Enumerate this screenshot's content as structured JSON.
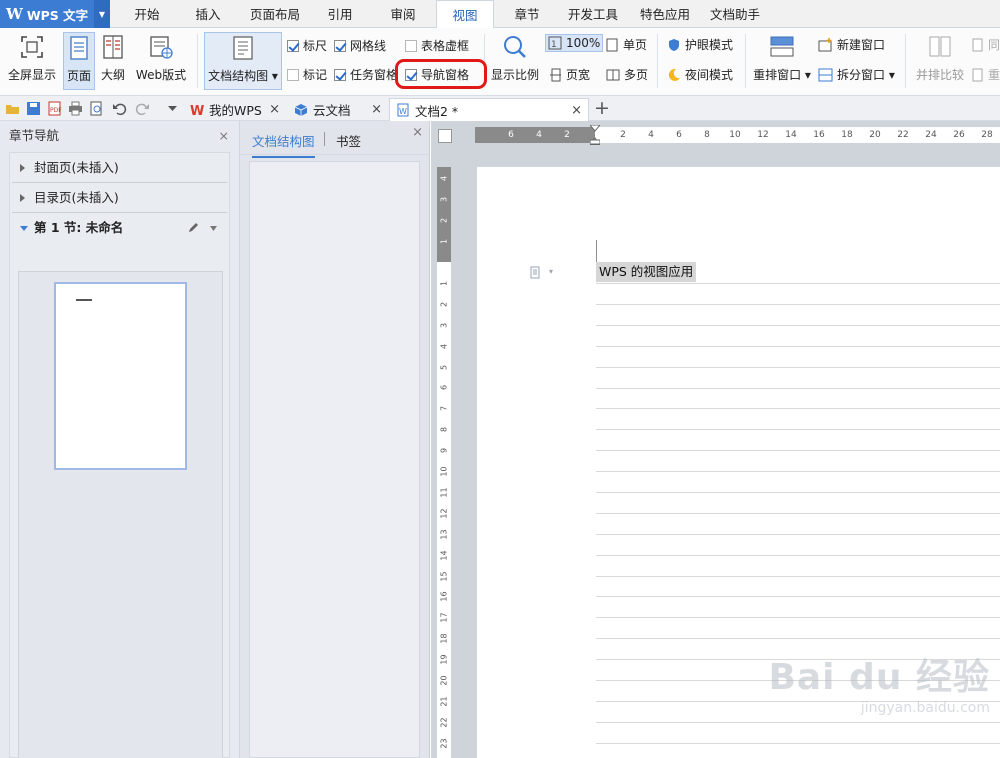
{
  "app": {
    "logo": "W",
    "title": "WPS 文字"
  },
  "menu_tabs": [
    {
      "label": "开始",
      "active": false
    },
    {
      "label": "插入",
      "active": false
    },
    {
      "label": "页面布局",
      "active": false
    },
    {
      "label": "引用",
      "active": false
    },
    {
      "label": "审阅",
      "active": false
    },
    {
      "label": "视图",
      "active": true
    },
    {
      "label": "章节",
      "active": false
    },
    {
      "label": "开发工具",
      "active": false
    },
    {
      "label": "特色应用",
      "active": false
    },
    {
      "label": "文档助手",
      "active": false
    }
  ],
  "ribbon": {
    "fullscreen": "全屏显示",
    "page_view": "页面",
    "outline": "大纲",
    "web_view": "Web版式",
    "doc_structure": "文档结构图",
    "ruler": "标尺",
    "gridlines": "网格线",
    "table_grid": "表格虚框",
    "marks": "标记",
    "task_pane": "任务窗格",
    "nav_pane": "导航窗格",
    "zoom": "显示比例",
    "zoom_value": "100%",
    "single_page": "单页",
    "page_width": "页宽",
    "multi_page": "多页",
    "eye_mode": "护眼模式",
    "night_mode": "夜间模式",
    "arrange": "重排窗口",
    "new_window": "新建窗口",
    "split_window": "拆分窗口",
    "compare": "并排比较",
    "sync_trunc": "同",
    "reset_trunc": "重"
  },
  "checks": {
    "ruler": true,
    "gridlines": true,
    "table_grid": false,
    "marks": false,
    "task_pane": true,
    "nav_pane": true
  },
  "doc_tabs": [
    {
      "label": "我的WPS",
      "active": false
    },
    {
      "label": "云文档",
      "active": false
    },
    {
      "label": "文档2 *",
      "active": true
    }
  ],
  "add_tab": "+",
  "close_glyph": "×",
  "chapter_nav": {
    "title": "章节导航",
    "items": [
      {
        "label": "封面页(未插入)"
      },
      {
        "label": "目录页(未插入)"
      },
      {
        "label": "第 1 节: 未命名"
      }
    ]
  },
  "structure_pane": {
    "tab_structure": "文档结构图",
    "tab_bookmark": "书签"
  },
  "document": {
    "text": "WPS 的视图应用"
  },
  "hruler_labels": [
    "6",
    "4",
    "2",
    "2",
    "4",
    "6",
    "8",
    "10",
    "12",
    "14",
    "16",
    "18",
    "20",
    "22",
    "24",
    "26",
    "28"
  ],
  "vruler_labels": [
    "4",
    "3",
    "2",
    "1",
    "1",
    "2",
    "3",
    "4",
    "5",
    "6",
    "7",
    "8",
    "9",
    "10",
    "11",
    "12",
    "13",
    "14",
    "15",
    "16",
    "17",
    "18",
    "19",
    "20",
    "21",
    "22",
    "23"
  ],
  "watermark": {
    "brand": "Bai du 经验",
    "url": "jingyan.baidu.com"
  }
}
